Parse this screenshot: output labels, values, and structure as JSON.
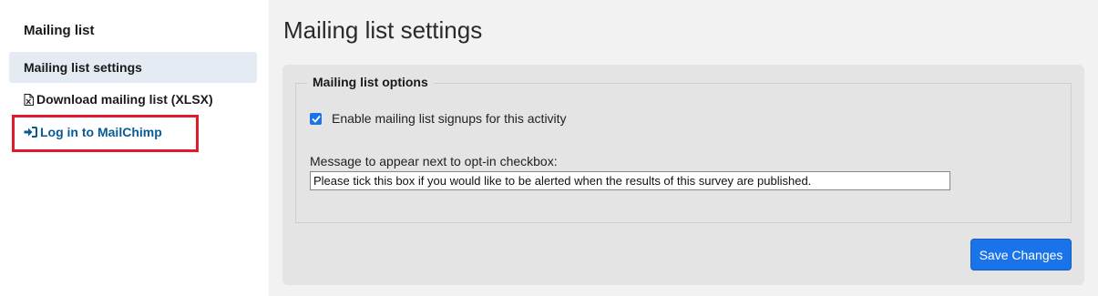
{
  "sidebar": {
    "title": "Mailing list",
    "items": [
      {
        "label": "Mailing list settings",
        "icon": "",
        "active": true
      },
      {
        "label": "Download mailing list (XLSX)",
        "icon": "file-excel-icon",
        "active": false
      },
      {
        "label": "Log in to MailChimp",
        "icon": "sign-in-icon",
        "active": false,
        "highlighted": true
      }
    ]
  },
  "main": {
    "title": "Mailing list settings",
    "fieldset": {
      "legend": "Mailing list options",
      "checkbox": {
        "label": "Enable mailing list signups for this activity",
        "checked": true
      },
      "message_label": "Message to appear next to opt-in checkbox:",
      "message_value": "Please tick this box if you would like to be alerted when the results of this survey are published."
    },
    "save_label": "Save Changes"
  },
  "colors": {
    "accent": "#1a73e8",
    "link": "#0a5a96",
    "highlight": "#e0192b",
    "active_nav_bg": "#e4ebf2"
  }
}
